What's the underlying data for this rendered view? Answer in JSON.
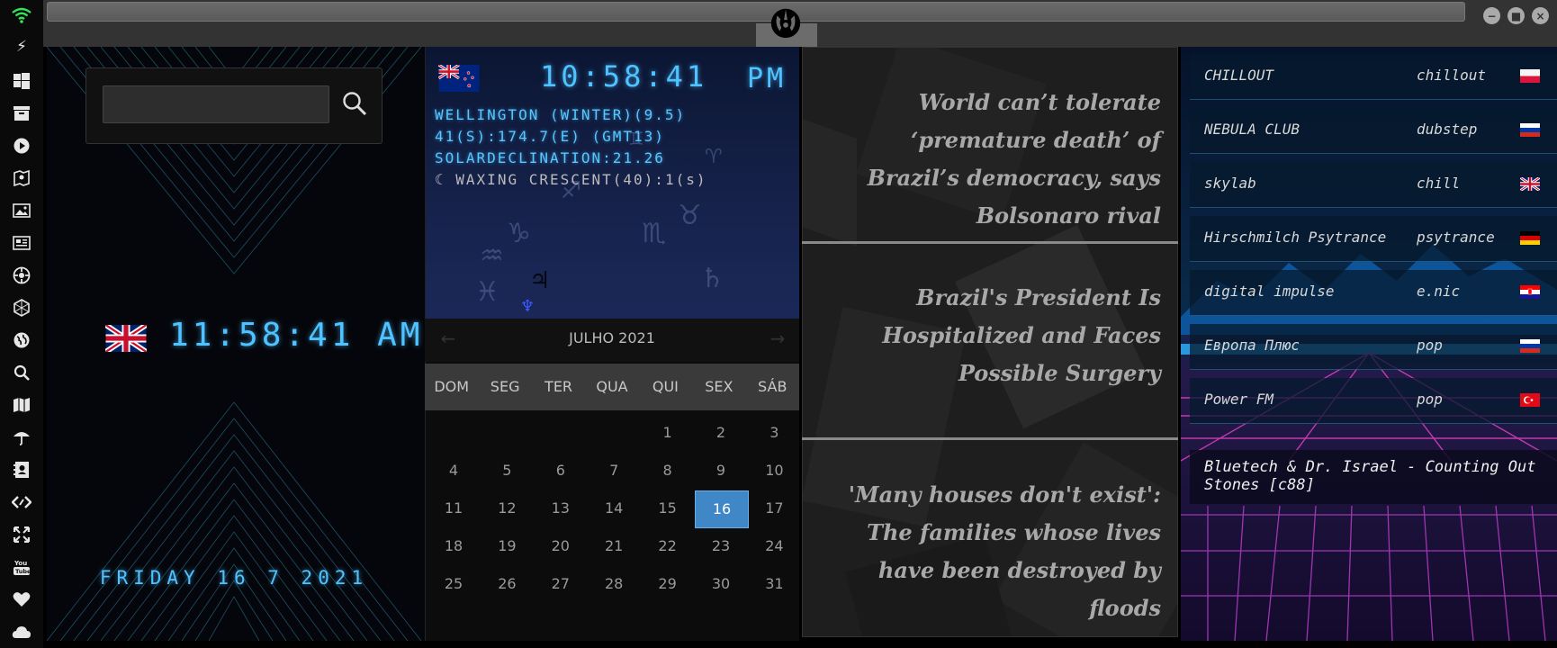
{
  "iconbar": {
    "icons": [
      "wifi-icon",
      "lightning-icon",
      "windows-icon",
      "archive-icon",
      "play-icon",
      "gallery-icon",
      "image-icon",
      "news-icon",
      "settings-icon",
      "network-icon",
      "globe-icon",
      "search-icon",
      "map-icon",
      "umbrella-icon",
      "contact-icon",
      "code-icon",
      "expand-icon",
      "youtube-icon",
      "heart-icon",
      "cloud-icon"
    ],
    "wifi_color": "#35e05a"
  },
  "window": {
    "minimize": "−",
    "maximize": "■",
    "close": "×"
  },
  "clock_uk": {
    "time": "11:58:41",
    "ampm": "AM",
    "date": "FRIDAY 16 7 2021",
    "digit_color": "#4fc3ff"
  },
  "search": {
    "value": "",
    "placeholder": ""
  },
  "clock_nz": {
    "time": "10:58:41",
    "ampm": "PM",
    "city": "WELLINGTON (WINTER)(9.5)",
    "coords": "41(S):174.7(E) (GMT13)",
    "solar": "SOLARDECLINATION:21.26",
    "moon": "WAXING CRESCENT(40):1(s)"
  },
  "calendar": {
    "prev": "←",
    "next": "→",
    "month": "JULHO 2021",
    "weekdays": [
      "DOM",
      "SEG",
      "TER",
      "QUA",
      "QUI",
      "SEX",
      "SÁB"
    ],
    "weeks": [
      [
        "",
        "",
        "",
        "",
        "1",
        "2",
        "3"
      ],
      [
        "4",
        "5",
        "6",
        "7",
        "8",
        "9",
        "10"
      ],
      [
        "11",
        "12",
        "13",
        "14",
        "15",
        "16",
        "17"
      ],
      [
        "18",
        "19",
        "20",
        "21",
        "22",
        "23",
        "24"
      ],
      [
        "25",
        "26",
        "27",
        "28",
        "29",
        "30",
        "31"
      ]
    ],
    "today": "16",
    "accent": "#3f87c7"
  },
  "news": {
    "items": [
      "World can’t tolerate ‘premature death’ of Brazil’s democracy, says Bolsonaro rival",
      "Brazil's President Is Hospitalized and Faces Possible Surgery",
      "'Many houses don't exist': The families whose lives have been destroyed by floods"
    ]
  },
  "radio": {
    "stations": [
      {
        "name": "CHILLOUT",
        "genre": "chillout",
        "flag": "pl"
      },
      {
        "name": "NEBULA CLUB",
        "genre": "dubstep",
        "flag": "ru"
      },
      {
        "name": "skylab",
        "genre": "chill",
        "flag": "uk"
      },
      {
        "name": "Hirschmilch Psytrance",
        "genre": "psytrance",
        "flag": "de"
      },
      {
        "name": "digital impulse",
        "genre": "e.nic",
        "flag": "hr"
      },
      {
        "name": "Европа Плюс",
        "genre": "pop",
        "flag": "ru"
      },
      {
        "name": "Power FM",
        "genre": "pop",
        "flag": "tr"
      }
    ],
    "now_playing": "Bluetech & Dr. Israel - Counting Out Stones [c88]"
  }
}
